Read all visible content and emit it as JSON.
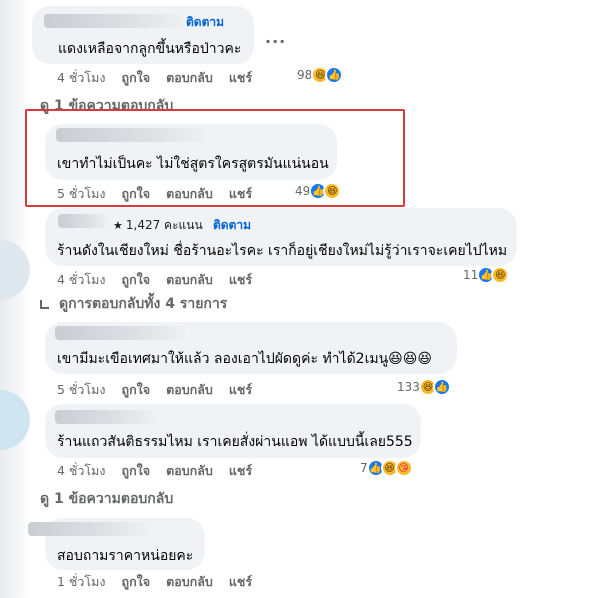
{
  "comments": [
    {
      "follow": "ติดตาม",
      "text": "แดงเหลือจากลูกขึ้นหรือป่าวคะ",
      "time": "4 ชั่วโมง",
      "like": "ถูกใจ",
      "reply": "ตอบกลับ",
      "share": "แชร์",
      "reactions": "98",
      "more": "...",
      "replies_link": "ดู 1 ข้อความตอบกลับ"
    },
    {
      "text": "เขาทำไม่เป็นคะ ไม่ใช่สูตรใครสูตรมันแน่นอน",
      "time": "5 ชั่วโมง",
      "like": "ถูกใจ",
      "reply": "ตอบกลับ",
      "share": "แชร์",
      "reactions": "49"
    },
    {
      "badge": "1,427 คะแนน",
      "follow": "ติดตาม",
      "text": "ร้านดังในเชียงใหม่ ชื่อร้านอะไรคะ เราก็อยู่เชียงใหม่ไม่รู้ว่าเราจะเคยไปไหม",
      "time": "4 ชั่วโมง",
      "like": "ถูกใจ",
      "reply": "ตอบกลับ",
      "share": "แชร์",
      "reactions": "11",
      "replies_link": "ดูการตอบกลับทั้ง 4 รายการ"
    },
    {
      "text": "เขามีมะเขือเทศมาให้แล้ว ลองเอาไปผัดดูค่ะ ทำได้2เมนู😆😆😆",
      "time": "5 ชั่วโมง",
      "like": "ถูกใจ",
      "reply": "ตอบกลับ",
      "share": "แชร์",
      "reactions": "133"
    },
    {
      "text": "ร้านแถวสันติธรรมไหม เราเคยสั่งผ่านแอพ ได้แบบนี้เลย555",
      "time": "4 ชั่วโมง",
      "like": "ถูกใจ",
      "reply": "ตอบกลับ",
      "share": "แชร์",
      "reactions": "7",
      "replies_link": "ดู 1 ข้อความตอบกลับ"
    },
    {
      "text": "สอบถามราคาหน่อยคะ",
      "time": "1 ชั่วโมง",
      "like": "ถูกใจ",
      "reply": "ตอบกลับ",
      "share": "แชร์"
    }
  ],
  "colors": {
    "highlight": "#d43d3d",
    "link": "#0064d1",
    "bubble": "#f0f2f5",
    "like": "#1877f2",
    "haha": "#f7b928"
  },
  "icons": {
    "like": "like-icon",
    "haha": "haha-icon",
    "care": "care-icon",
    "star": "star-icon"
  }
}
